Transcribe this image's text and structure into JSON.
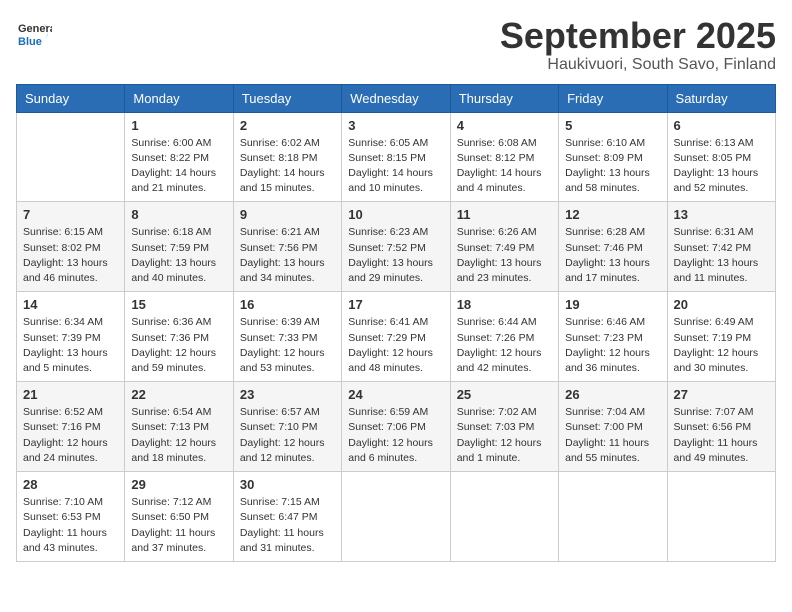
{
  "header": {
    "logo_general": "General",
    "logo_blue": "Blue",
    "month_title": "September 2025",
    "location": "Haukivuori, South Savo, Finland"
  },
  "days_of_week": [
    "Sunday",
    "Monday",
    "Tuesday",
    "Wednesday",
    "Thursday",
    "Friday",
    "Saturday"
  ],
  "weeks": [
    [
      {
        "day": "",
        "info": ""
      },
      {
        "day": "1",
        "info": "Sunrise: 6:00 AM\nSunset: 8:22 PM\nDaylight: 14 hours\nand 21 minutes."
      },
      {
        "day": "2",
        "info": "Sunrise: 6:02 AM\nSunset: 8:18 PM\nDaylight: 14 hours\nand 15 minutes."
      },
      {
        "day": "3",
        "info": "Sunrise: 6:05 AM\nSunset: 8:15 PM\nDaylight: 14 hours\nand 10 minutes."
      },
      {
        "day": "4",
        "info": "Sunrise: 6:08 AM\nSunset: 8:12 PM\nDaylight: 14 hours\nand 4 minutes."
      },
      {
        "day": "5",
        "info": "Sunrise: 6:10 AM\nSunset: 8:09 PM\nDaylight: 13 hours\nand 58 minutes."
      },
      {
        "day": "6",
        "info": "Sunrise: 6:13 AM\nSunset: 8:05 PM\nDaylight: 13 hours\nand 52 minutes."
      }
    ],
    [
      {
        "day": "7",
        "info": "Sunrise: 6:15 AM\nSunset: 8:02 PM\nDaylight: 13 hours\nand 46 minutes."
      },
      {
        "day": "8",
        "info": "Sunrise: 6:18 AM\nSunset: 7:59 PM\nDaylight: 13 hours\nand 40 minutes."
      },
      {
        "day": "9",
        "info": "Sunrise: 6:21 AM\nSunset: 7:56 PM\nDaylight: 13 hours\nand 34 minutes."
      },
      {
        "day": "10",
        "info": "Sunrise: 6:23 AM\nSunset: 7:52 PM\nDaylight: 13 hours\nand 29 minutes."
      },
      {
        "day": "11",
        "info": "Sunrise: 6:26 AM\nSunset: 7:49 PM\nDaylight: 13 hours\nand 23 minutes."
      },
      {
        "day": "12",
        "info": "Sunrise: 6:28 AM\nSunset: 7:46 PM\nDaylight: 13 hours\nand 17 minutes."
      },
      {
        "day": "13",
        "info": "Sunrise: 6:31 AM\nSunset: 7:42 PM\nDaylight: 13 hours\nand 11 minutes."
      }
    ],
    [
      {
        "day": "14",
        "info": "Sunrise: 6:34 AM\nSunset: 7:39 PM\nDaylight: 13 hours\nand 5 minutes."
      },
      {
        "day": "15",
        "info": "Sunrise: 6:36 AM\nSunset: 7:36 PM\nDaylight: 12 hours\nand 59 minutes."
      },
      {
        "day": "16",
        "info": "Sunrise: 6:39 AM\nSunset: 7:33 PM\nDaylight: 12 hours\nand 53 minutes."
      },
      {
        "day": "17",
        "info": "Sunrise: 6:41 AM\nSunset: 7:29 PM\nDaylight: 12 hours\nand 48 minutes."
      },
      {
        "day": "18",
        "info": "Sunrise: 6:44 AM\nSunset: 7:26 PM\nDaylight: 12 hours\nand 42 minutes."
      },
      {
        "day": "19",
        "info": "Sunrise: 6:46 AM\nSunset: 7:23 PM\nDaylight: 12 hours\nand 36 minutes."
      },
      {
        "day": "20",
        "info": "Sunrise: 6:49 AM\nSunset: 7:19 PM\nDaylight: 12 hours\nand 30 minutes."
      }
    ],
    [
      {
        "day": "21",
        "info": "Sunrise: 6:52 AM\nSunset: 7:16 PM\nDaylight: 12 hours\nand 24 minutes."
      },
      {
        "day": "22",
        "info": "Sunrise: 6:54 AM\nSunset: 7:13 PM\nDaylight: 12 hours\nand 18 minutes."
      },
      {
        "day": "23",
        "info": "Sunrise: 6:57 AM\nSunset: 7:10 PM\nDaylight: 12 hours\nand 12 minutes."
      },
      {
        "day": "24",
        "info": "Sunrise: 6:59 AM\nSunset: 7:06 PM\nDaylight: 12 hours\nand 6 minutes."
      },
      {
        "day": "25",
        "info": "Sunrise: 7:02 AM\nSunset: 7:03 PM\nDaylight: 12 hours\nand 1 minute."
      },
      {
        "day": "26",
        "info": "Sunrise: 7:04 AM\nSunset: 7:00 PM\nDaylight: 11 hours\nand 55 minutes."
      },
      {
        "day": "27",
        "info": "Sunrise: 7:07 AM\nSunset: 6:56 PM\nDaylight: 11 hours\nand 49 minutes."
      }
    ],
    [
      {
        "day": "28",
        "info": "Sunrise: 7:10 AM\nSunset: 6:53 PM\nDaylight: 11 hours\nand 43 minutes."
      },
      {
        "day": "29",
        "info": "Sunrise: 7:12 AM\nSunset: 6:50 PM\nDaylight: 11 hours\nand 37 minutes."
      },
      {
        "day": "30",
        "info": "Sunrise: 7:15 AM\nSunset: 6:47 PM\nDaylight: 11 hours\nand 31 minutes."
      },
      {
        "day": "",
        "info": ""
      },
      {
        "day": "",
        "info": ""
      },
      {
        "day": "",
        "info": ""
      },
      {
        "day": "",
        "info": ""
      }
    ]
  ]
}
